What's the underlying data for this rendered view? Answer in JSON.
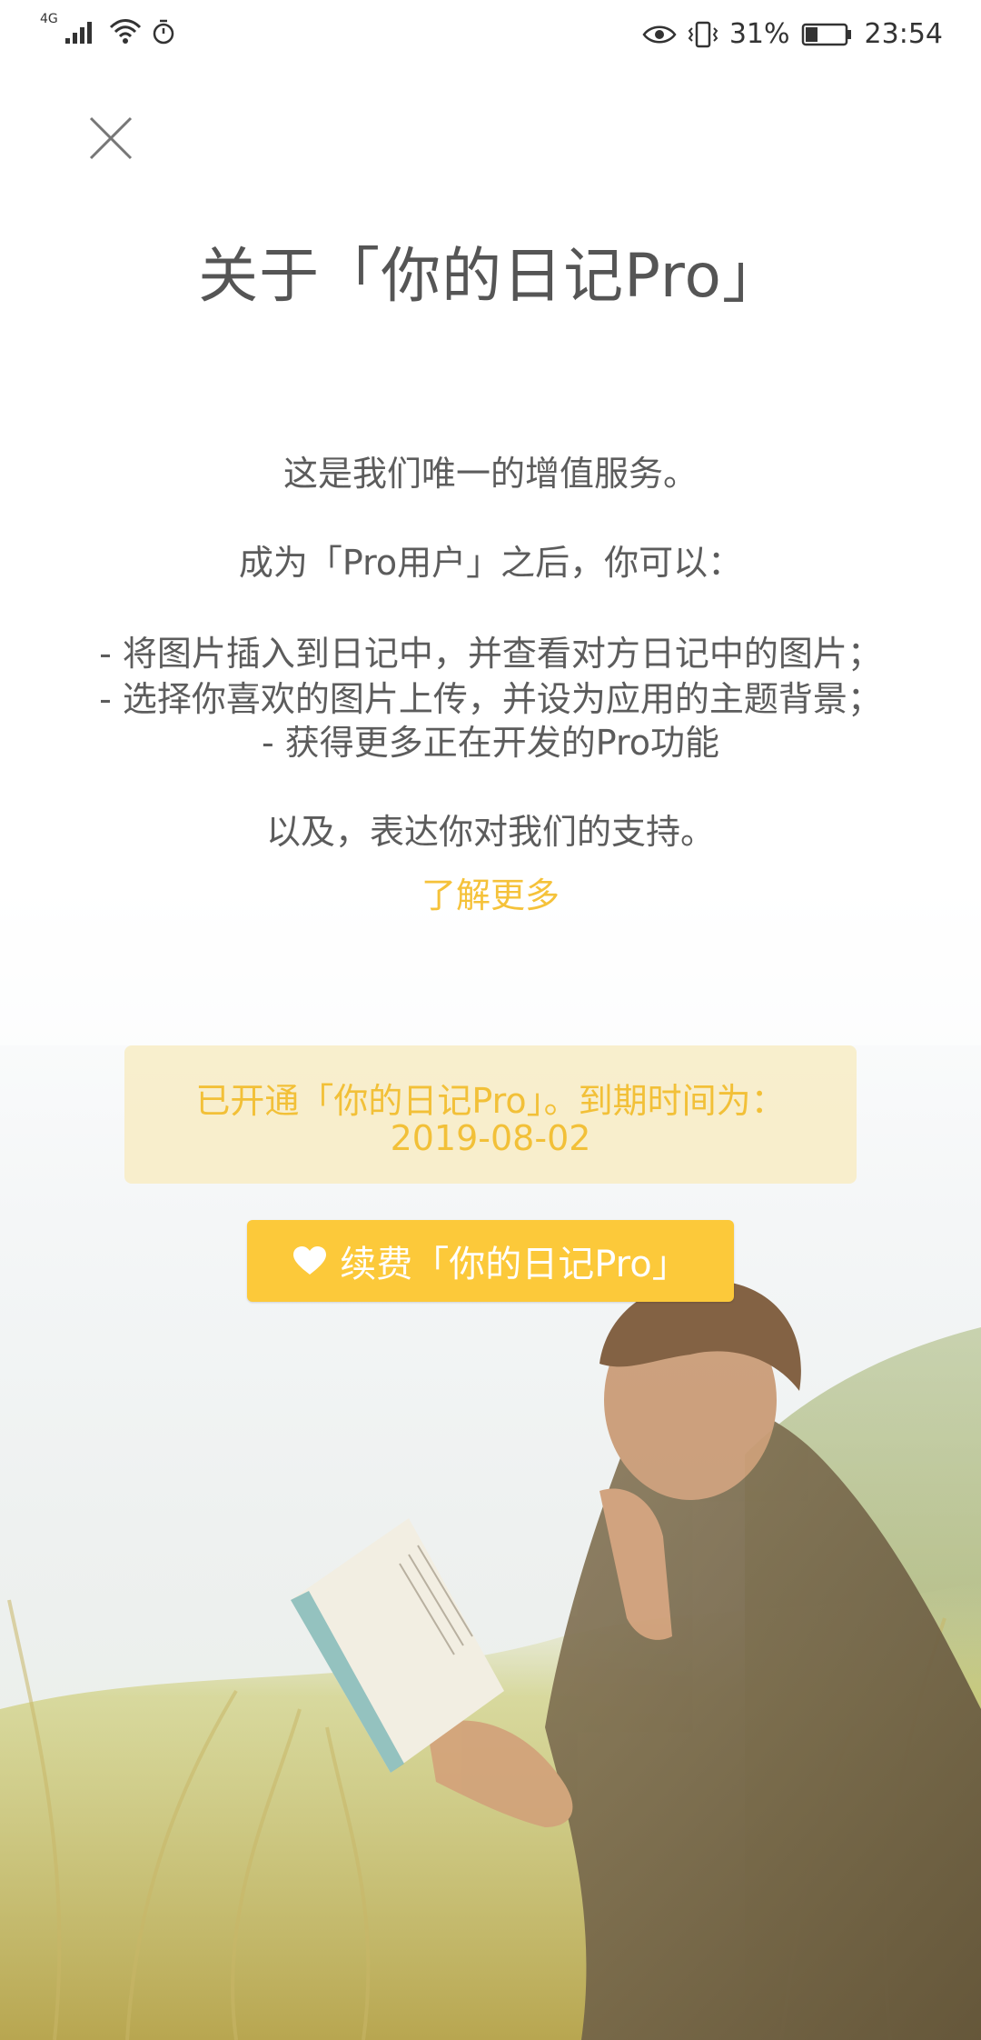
{
  "status_bar": {
    "network": "4G",
    "battery": "31%",
    "battery_level": 0.31,
    "time": "23:54"
  },
  "page": {
    "title": "关于「你的日记Pro」",
    "intro": "这是我们唯一的增值服务。",
    "become_pro": "成为「Pro用户」之后，你可以：",
    "features": [
      "- 将图片插入到日记中，并查看对方日记中的图片；",
      "- 选择你喜欢的图片上传，并设为应用的主题背景；",
      "- 获得更多正在开发的Pro功能"
    ],
    "support": "以及，表达你对我们的支持。",
    "learn_more": "了解更多"
  },
  "subscription": {
    "status_text": "已开通「你的日记Pro」。到期时间为：",
    "expiry_date": "2019-08-02"
  },
  "renew_button": {
    "label": "续费「你的日记Pro」",
    "icon": "heart-icon"
  },
  "colors": {
    "accent": "#fcc93a",
    "accent_text": "#f2c038",
    "card_bg": "#f8ecc4",
    "text": "#555555"
  }
}
